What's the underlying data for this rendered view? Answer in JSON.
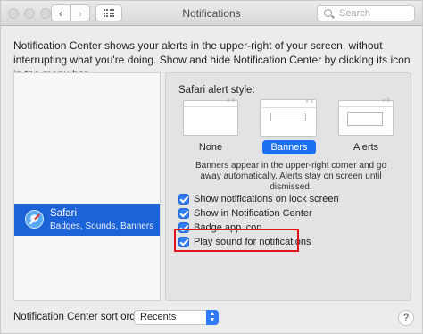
{
  "window": {
    "title": "Notifications",
    "search_placeholder": "Search"
  },
  "description": "Notification Center shows your alerts in the upper-right of your screen, without interrupting what you're doing. Show and hide Notification Center by clicking its icon in the menu bar.",
  "sidebar": {
    "items": [
      {
        "name": "Safari",
        "detail": "Badges, Sounds, Banners",
        "icon": "safari-icon",
        "selected": true
      }
    ]
  },
  "panel": {
    "alert_style_label": "Safari alert style:",
    "styles": [
      {
        "label": "None",
        "selected": false
      },
      {
        "label": "Banners",
        "selected": true
      },
      {
        "label": "Alerts",
        "selected": false
      }
    ],
    "style_description": "Banners appear in the upper-right corner and go away automatically. Alerts stay on screen until dismissed.",
    "options": [
      {
        "label": "Show notifications on lock screen",
        "checked": true
      },
      {
        "label": "Show in Notification Center",
        "checked": true
      },
      {
        "label": "Badge app icon",
        "checked": true
      },
      {
        "label": "Play sound for notifications",
        "checked": true
      }
    ]
  },
  "footer": {
    "sort_label": "Notification Center sort order:",
    "sort_value": "Recents",
    "help_label": "?"
  },
  "colors": {
    "selection": "#1b63d6",
    "accent": "#2f7cf6",
    "highlight": "#e2141c"
  }
}
